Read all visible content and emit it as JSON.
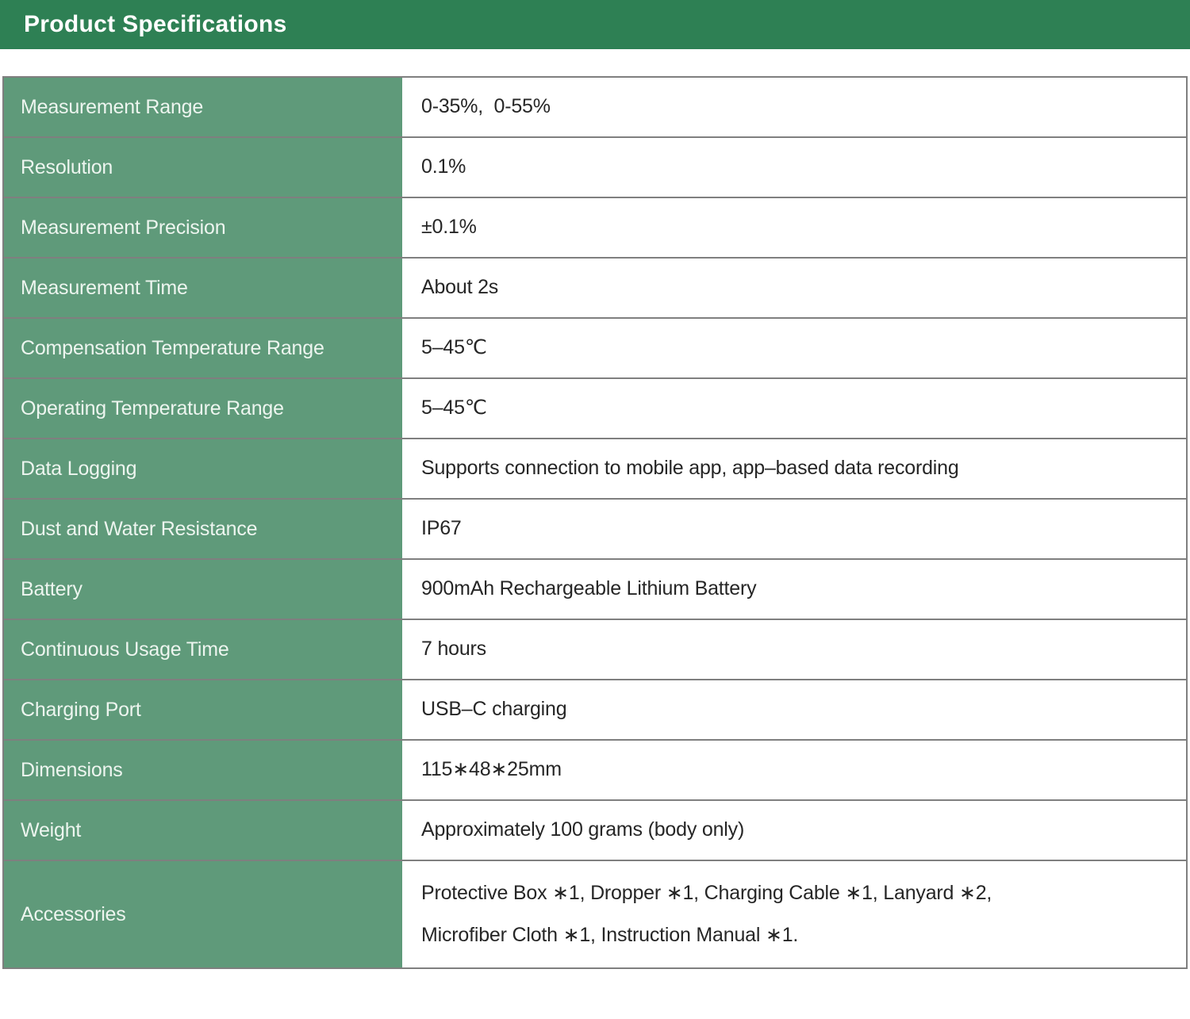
{
  "page_title": "Product Specifications",
  "colors": {
    "header_green": "#2E8054",
    "row_green": "#5F9A7A",
    "label_text": "#EDF5EF",
    "value_text": "#262626"
  },
  "table": {
    "rows": [
      {
        "label": "Measurement Range",
        "value_lines": [
          "0-35%,  0-55%"
        ]
      },
      {
        "label": "Resolution",
        "value_lines": [
          "0.1%"
        ]
      },
      {
        "label": "Measurement Precision",
        "value_lines": [
          "±0.1%"
        ]
      },
      {
        "label": "Measurement Time",
        "value_lines": [
          "About 2s"
        ]
      },
      {
        "label": "Compensation Temperature Range",
        "value_lines": [
          "5–45℃"
        ]
      },
      {
        "label": "Operating Temperature Range",
        "value_lines": [
          "5–45℃"
        ]
      },
      {
        "label": "Data Logging",
        "value_lines": [
          "Supports connection to mobile app, app–based data recording"
        ]
      },
      {
        "label": "Dust and Water Resistance",
        "value_lines": [
          "IP67"
        ]
      },
      {
        "label": "Battery",
        "value_lines": [
          "900mAh Rechargeable Lithium Battery"
        ]
      },
      {
        "label": "Continuous Usage Time",
        "value_lines": [
          "7 hours"
        ]
      },
      {
        "label": "Charging Port",
        "value_lines": [
          "USB–C charging"
        ]
      },
      {
        "label": "Dimensions",
        "value_lines": [
          "115∗48∗25mm"
        ]
      },
      {
        "label": "Weight",
        "value_lines": [
          "Approximately 100 grams (body only)"
        ]
      },
      {
        "label": "Accessories",
        "value_lines": [
          "Protective Box ∗1, Dropper ∗1, Charging Cable ∗1, Lanyard ∗2,",
          "Microfiber Cloth ∗1, Instruction Manual ∗1."
        ]
      }
    ]
  }
}
